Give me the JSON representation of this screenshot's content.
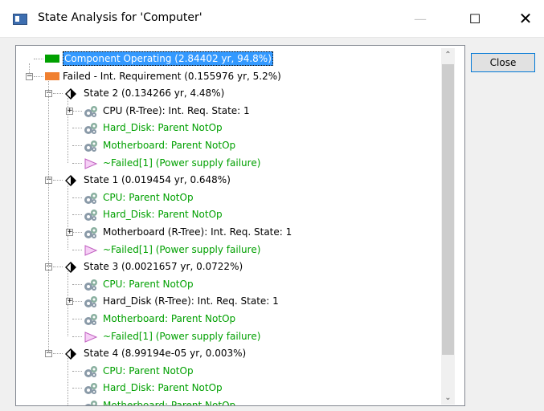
{
  "window": {
    "title": "State Analysis for 'Computer'",
    "minimize_glyph": "—",
    "maximize_glyph": "☐",
    "close_glyph": "✕"
  },
  "close_button_label": "Close",
  "scrollbar": {
    "up": "⌃",
    "down": "⌄"
  },
  "tree": [
    {
      "text": "Component Operating (2.84402 yr, 94.8%)",
      "icon": "green-square-icon",
      "color": "selected"
    },
    {
      "text": "Failed - Int. Requirement (0.155976 yr, 5.2%)",
      "icon": "orange-square-icon",
      "color": "black"
    },
    {
      "text": "State 2 (0.134266 yr, 4.48%)",
      "icon": "diamond-icon",
      "color": "black"
    },
    {
      "text": "CPU (R-Tree): Int. Req. State: 1",
      "icon": "gears-icon",
      "color": "black"
    },
    {
      "text": "Hard_Disk: Parent NotOp",
      "icon": "gears-icon",
      "color": "green"
    },
    {
      "text": "Motherboard: Parent NotOp",
      "icon": "gears-icon",
      "color": "green"
    },
    {
      "text": "~Failed[1]  (Power supply failure)",
      "icon": "gate-icon",
      "color": "green"
    },
    {
      "text": "State 1 (0.019454 yr, 0.648%)",
      "icon": "diamond-icon",
      "color": "black"
    },
    {
      "text": "CPU: Parent NotOp",
      "icon": "gears-icon",
      "color": "green"
    },
    {
      "text": "Hard_Disk: Parent NotOp",
      "icon": "gears-icon",
      "color": "green"
    },
    {
      "text": "Motherboard (R-Tree): Int. Req. State: 1",
      "icon": "gears-icon",
      "color": "black"
    },
    {
      "text": "~Failed[1]  (Power supply failure)",
      "icon": "gate-icon",
      "color": "green"
    },
    {
      "text": "State 3 (0.0021657 yr, 0.0722%)",
      "icon": "diamond-icon",
      "color": "black"
    },
    {
      "text": "CPU: Parent NotOp",
      "icon": "gears-icon",
      "color": "green"
    },
    {
      "text": "Hard_Disk (R-Tree): Int. Req. State: 1",
      "icon": "gears-icon",
      "color": "black"
    },
    {
      "text": "Motherboard: Parent NotOp",
      "icon": "gears-icon",
      "color": "green"
    },
    {
      "text": "~Failed[1]  (Power supply failure)",
      "icon": "gate-icon",
      "color": "green"
    },
    {
      "text": "State 4 (8.99194e-05 yr, 0.003%)",
      "icon": "diamond-icon",
      "color": "black"
    },
    {
      "text": "CPU: Parent NotOp",
      "icon": "gears-icon",
      "color": "green"
    },
    {
      "text": "Hard_Disk: Parent NotOp",
      "icon": "gears-icon",
      "color": "green"
    },
    {
      "text": "Motherboard: Parent NotOp",
      "icon": "gears-icon",
      "color": "green"
    }
  ],
  "colors": {
    "green_text": "#00a000",
    "selection": "#3399ff",
    "operating_square": "#00a000",
    "failed_square": "#f08030",
    "gate": "#d070d0"
  }
}
